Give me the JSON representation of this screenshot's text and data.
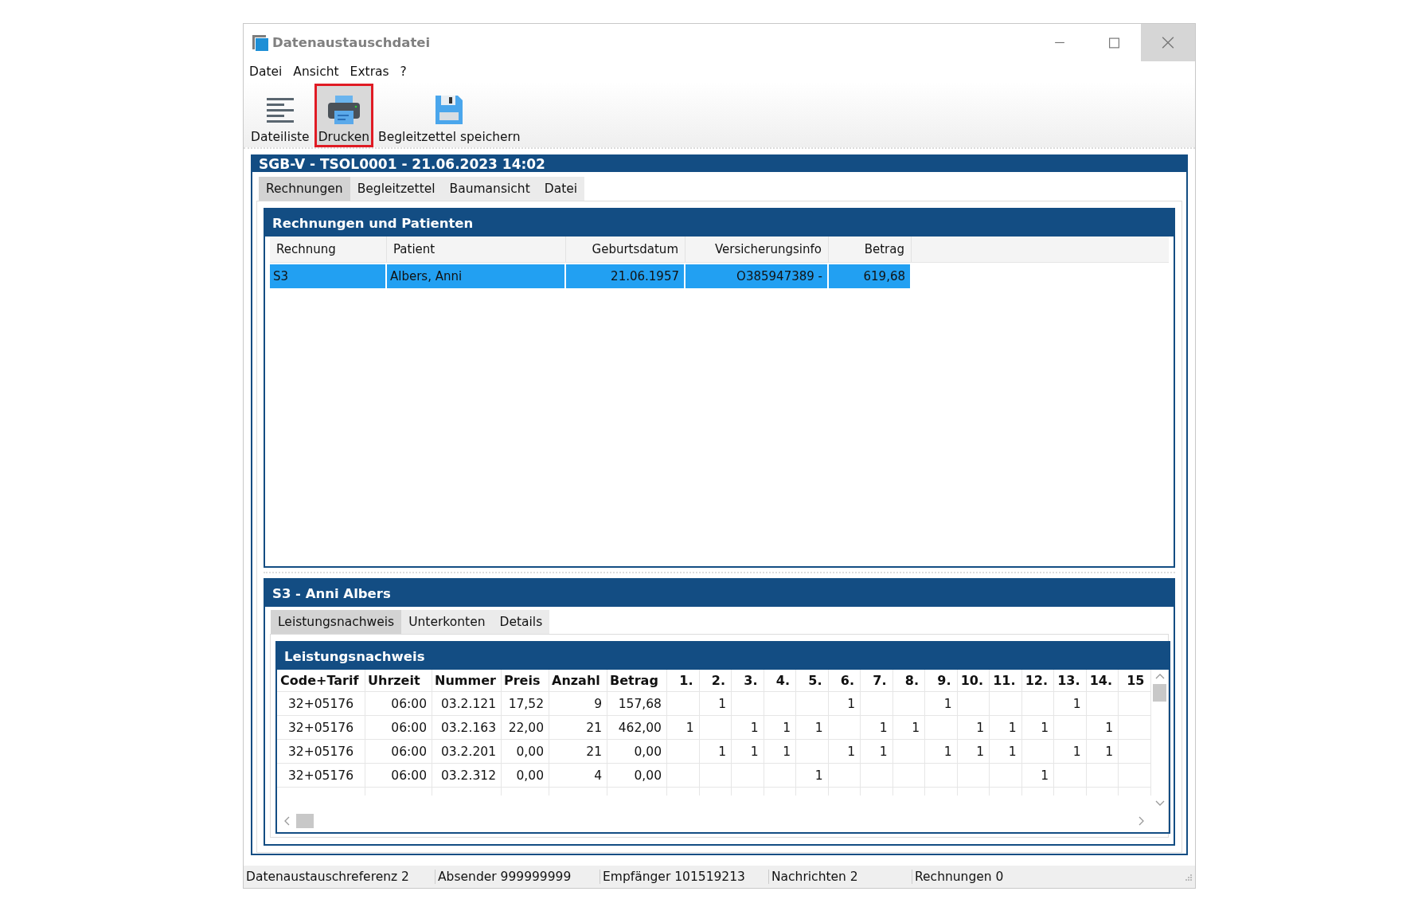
{
  "window": {
    "title": "Datenaustauschdatei"
  },
  "menu": [
    "Datei",
    "Ansicht",
    "Extras",
    "?"
  ],
  "toolbar": [
    {
      "label": "Dateiliste",
      "kind": "list",
      "selected": false
    },
    {
      "label": "Drucken",
      "kind": "print",
      "selected": true
    },
    {
      "label": "Begleitzettel speichern",
      "kind": "save",
      "selected": false
    }
  ],
  "file_panel": {
    "title": "SGB-V - TSOL0001 - 21.06.2023 14:02",
    "tabs": [
      {
        "label": "Rechnungen",
        "selected": true
      },
      {
        "label": "Begleitzettel",
        "selected": false
      },
      {
        "label": "Baumansicht",
        "selected": false
      },
      {
        "label": "Datei",
        "selected": false
      }
    ]
  },
  "invoices": {
    "title": "Rechnungen und Patienten",
    "columns": [
      "Rechnung",
      "Patient",
      "Geburtsdatum",
      "Versicherungsinfo",
      "Betrag"
    ],
    "rows": [
      {
        "cells": [
          "S3",
          "Albers, Anni",
          "21.06.1957",
          "O385947389 -",
          "619,68"
        ],
        "selected": true
      }
    ]
  },
  "invoice_detail": {
    "title": "S3 - Anni Albers",
    "tabs": [
      {
        "label": "Leistungsnachweis",
        "selected": true
      },
      {
        "label": "Unterkonten",
        "selected": false
      },
      {
        "label": "Details",
        "selected": false
      }
    ],
    "services": {
      "title": "Leistungsnachweis",
      "columns": [
        "Code+Tarif",
        "Uhrzeit",
        "Nummer",
        "Preis",
        "Anzahl",
        "Betrag",
        "1.",
        "2.",
        "3.",
        "4.",
        "5.",
        "6.",
        "7.",
        "8.",
        "9.",
        "10.",
        "11.",
        "12.",
        "13.",
        "14.",
        "15"
      ],
      "rows": [
        {
          "cells": [
            "32+05176",
            "06:00",
            "03.2.121",
            "17,52",
            "9",
            "157,68",
            null,
            "1",
            null,
            null,
            null,
            "1",
            null,
            null,
            "1",
            null,
            null,
            null,
            "1",
            null,
            null
          ]
        },
        {
          "cells": [
            "32+05176",
            "06:00",
            "03.2.163",
            "22,00",
            "21",
            "462,00",
            "1",
            null,
            "1",
            "1",
            "1",
            null,
            "1",
            "1",
            null,
            "1",
            "1",
            "1",
            null,
            "1",
            null
          ]
        },
        {
          "cells": [
            "32+05176",
            "06:00",
            "03.2.201",
            "0,00",
            "21",
            "0,00",
            null,
            "1",
            "1",
            "1",
            null,
            "1",
            "1",
            null,
            "1",
            "1",
            "1",
            null,
            "1",
            "1",
            null
          ]
        },
        {
          "cells": [
            "32+05176",
            "06:00",
            "03.2.312",
            "0,00",
            "4",
            "0,00",
            null,
            null,
            null,
            null,
            "1",
            null,
            null,
            null,
            null,
            null,
            null,
            "1",
            null,
            null,
            null
          ]
        }
      ]
    }
  },
  "status_bar": [
    "Datenaustauschreferenz 2",
    "Absender 999999999",
    "Empfänger 101519213",
    "Nachrichten 2",
    "Rechnungen 0"
  ]
}
